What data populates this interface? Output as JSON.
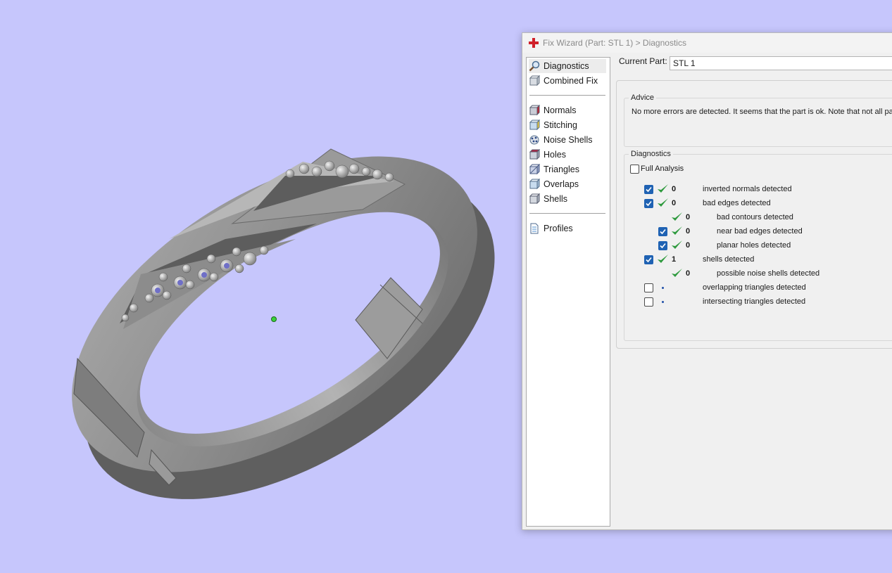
{
  "window": {
    "title": "Fix Wizard (Part: STL 1) > Diagnostics"
  },
  "nav": {
    "items": [
      {
        "label": "Diagnostics",
        "icon": "magnifier-icon"
      },
      {
        "label": "Combined Fix",
        "icon": "combined-fix-icon"
      },
      {
        "label": "Normals",
        "icon": "normals-cube-icon"
      },
      {
        "label": "Stitching",
        "icon": "stitching-cube-icon"
      },
      {
        "label": "Noise Shells",
        "icon": "noise-shells-icon"
      },
      {
        "label": "Holes",
        "icon": "holes-cube-icon"
      },
      {
        "label": "Triangles",
        "icon": "triangles-cube-icon"
      },
      {
        "label": "Overlaps",
        "icon": "overlaps-cube-icon"
      },
      {
        "label": "Shells",
        "icon": "shells-cube-icon"
      },
      {
        "label": "Profiles",
        "icon": "profiles-document-icon"
      }
    ]
  },
  "current_part": {
    "label": "Current Part:",
    "value": "STL 1"
  },
  "advice": {
    "title": "Advice",
    "text": "No more errors are detected. It seems that the part is ok. Note that not all pa"
  },
  "diagnostics": {
    "title": "Diagnostics",
    "full_analysis": {
      "label": "Full Analysis",
      "checked": false
    },
    "rows": [
      {
        "label": "inverted normals detected",
        "count": "0",
        "checked": true,
        "status": "ok"
      },
      {
        "label": "bad edges detected",
        "count": "0",
        "checked": true,
        "status": "ok"
      },
      {
        "label": "bad contours detected",
        "count": "0",
        "checked": null,
        "status": "ok"
      },
      {
        "label": "near bad edges detected",
        "count": "0",
        "checked": true,
        "status": "ok"
      },
      {
        "label": "planar holes detected",
        "count": "0",
        "checked": true,
        "status": "ok"
      },
      {
        "label": "shells detected",
        "count": "1",
        "checked": true,
        "status": "ok"
      },
      {
        "label": "possible noise shells detected",
        "count": "0",
        "checked": null,
        "status": "ok"
      },
      {
        "label": "overlapping triangles detected",
        "count": "",
        "checked": false,
        "status": "pending"
      },
      {
        "label": "intersecting triangles detected",
        "count": "",
        "checked": false,
        "status": "pending"
      }
    ]
  },
  "colors": {
    "viewport_bg": "#c6c6fc",
    "check_green": "#2e9a3e",
    "checkbox_blue": "#1f62b3",
    "model_gray": "#8c8c8c"
  }
}
